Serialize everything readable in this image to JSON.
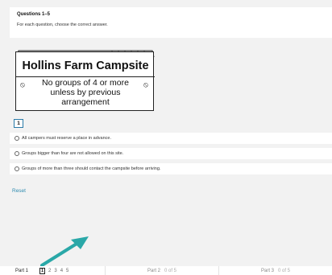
{
  "header": {
    "title": "Questions 1–5",
    "instruction": "For each question, choose the correct answer."
  },
  "sign": {
    "title": "Hollins Farm Campsite",
    "line1": "No groups of 4 or more",
    "line2": "unless by previous",
    "line3": "arrangement"
  },
  "question": {
    "number": "1",
    "options": [
      "All campers must reserve a place in advance.",
      "Groups bigger than four are not allowed on this site.",
      "Groups of more than three should contact the campsite before arriving."
    ]
  },
  "reset_label": "Reset",
  "nav": {
    "part1": {
      "label": "Part 1",
      "current": "1",
      "questions": [
        "2",
        "3",
        "4",
        "5"
      ]
    },
    "part2": {
      "label": "Part 2",
      "count": "0 of 5"
    },
    "part3": {
      "label": "Part 3",
      "count": "0 of 5"
    }
  },
  "colors": {
    "accent": "#2f8bb0",
    "arrow": "#2aa8a8"
  }
}
